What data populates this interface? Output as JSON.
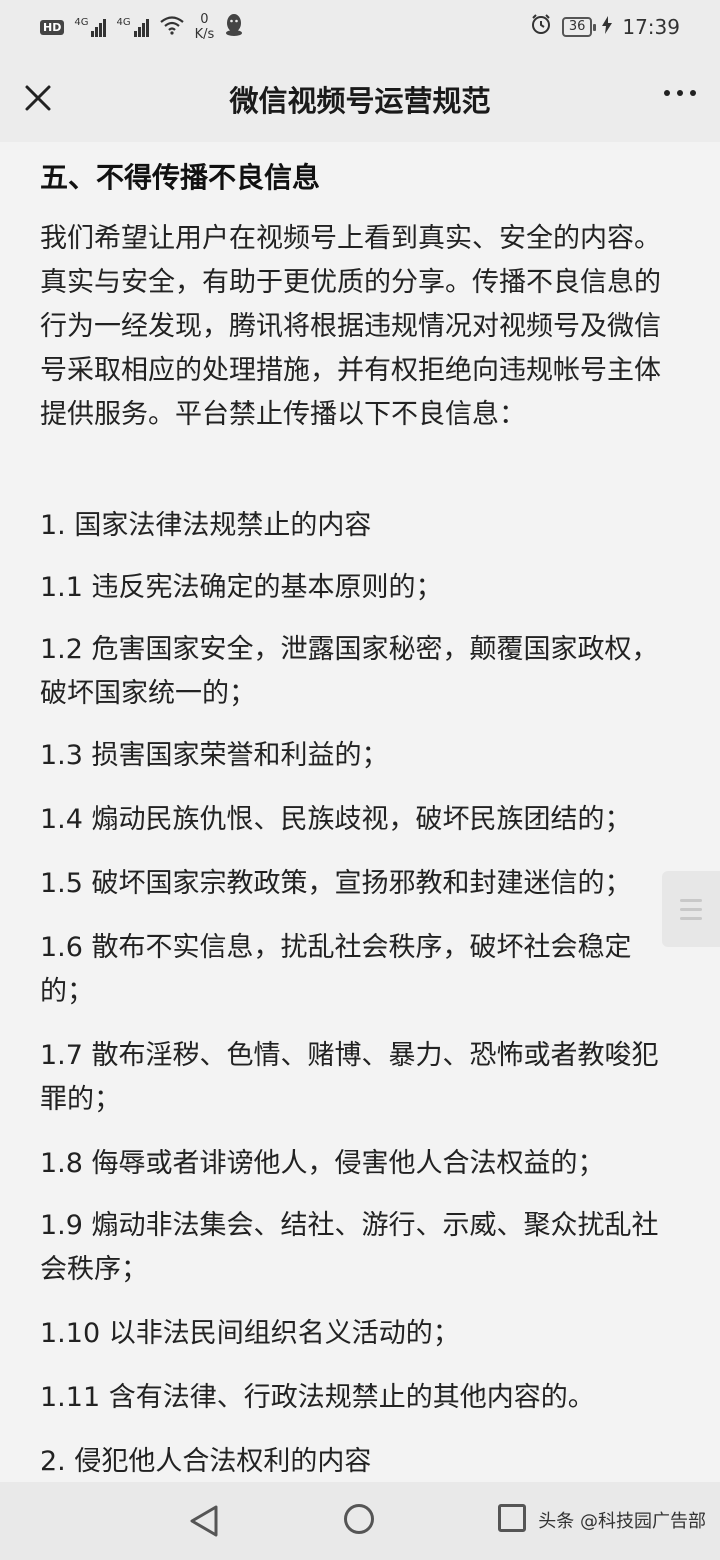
{
  "status_bar": {
    "hd_label": "HD",
    "signal_1_label": "4G",
    "signal_2_label": "4G",
    "speed_value": "0",
    "speed_unit": "K/s",
    "battery_level": "36",
    "time": "17:39"
  },
  "header": {
    "title": "微信视频号运营规范"
  },
  "article": {
    "section_heading": "五、不得传播不良信息",
    "intro": "我们希望让用户在视频号上看到真实、安全的内容。真实与安全，有助于更优质的分享。传播不良信息的行为一经发现，腾讯将根据违规情况对视频号及微信号采取相应的处理措施，并有权拒绝向违规帐号主体提供服务。平台禁止传播以下不良信息：",
    "items": [
      "1. 国家法律法规禁止的内容",
      "1.1 违反宪法确定的基本原则的；",
      "1.2 危害国家安全，泄露国家秘密，颠覆国家政权，破坏国家统一的；",
      "1.3 损害国家荣誉和利益的；",
      "1.4 煽动民族仇恨、民族歧视，破坏民族团结的；",
      "1.5 破坏国家宗教政策，宣扬邪教和封建迷信的；",
      "1.6 散布不实信息，扰乱社会秩序，破坏社会稳定的；",
      "1.7 散布淫秽、色情、赌博、暴力、恐怖或者教唆犯罪的；",
      "1.8 侮辱或者诽谤他人，侵害他人合法权益的；",
      "1.9 煽动非法集会、结社、游行、示威、聚众扰乱社会秩序；",
      "1.10 以非法民间组织名义活动的；",
      "1.11 含有法律、行政法规禁止的其他内容的。",
      "2. 侵犯他人合法权利的内容"
    ]
  },
  "watermark": "头条 @科技园广告部",
  "icons": {
    "close": "close-icon",
    "more": "more-icon",
    "back": "back-triangle-icon",
    "home": "home-circle-icon",
    "recent": "recent-apps-icon",
    "scroll": "scroll-handle-icon"
  }
}
